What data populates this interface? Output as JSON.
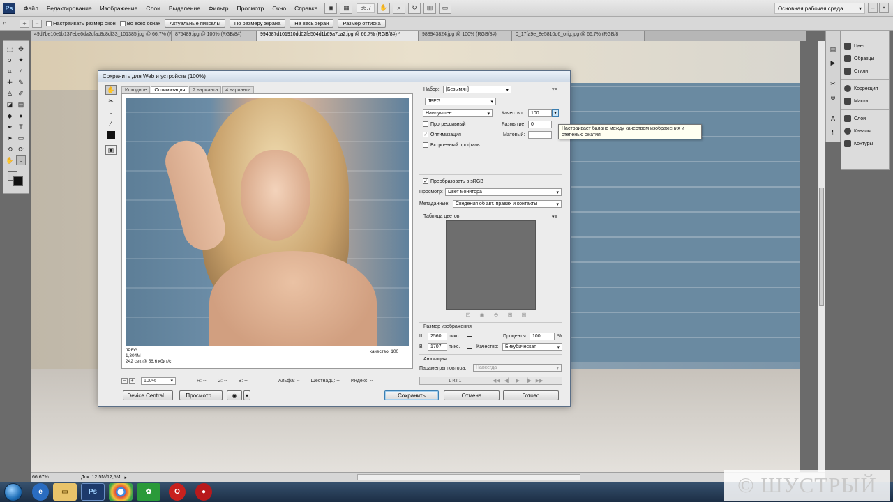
{
  "menubar": {
    "logo": "Ps",
    "items": [
      "Файл",
      "Редактирование",
      "Изображение",
      "Слои",
      "Выделение",
      "Фильтр",
      "Просмотр",
      "Окно",
      "Справка"
    ],
    "zoom": "66,7",
    "workspace": "Основная рабочая среда"
  },
  "options": {
    "resize_windows": "Настраивать размер окон",
    "all_windows": "Во всех окнах",
    "btn_actual": "Актуальные пикселы",
    "btn_fit": "По размеру экрана",
    "btn_fill": "На весь экран",
    "btn_print": "Размер оттиска"
  },
  "doc_tabs": [
    "49d7be10e1b137ebe6da2cfac8c8df33_101385.jpg @ 66,7% (RGB/8)",
    "875489.jpg @ 100% (RGB/8#)",
    "994687d101910dd02fe504d1b69a7ca2.jpg @ 66,7% (RGB/8#) *",
    "988943824.jpg @ 100% (RGB/8#)",
    "0_17fa9e_8e5810d6_orig.jpg @ 66,7% (RGB/8"
  ],
  "status": {
    "zoom": "66,67%",
    "doc": "Док: 12,5M/12,5M"
  },
  "panels": {
    "group1": [
      "Цвет",
      "Образцы",
      "Стили"
    ],
    "group2": [
      "Коррекция",
      "Маски"
    ],
    "group3": [
      "Слои",
      "Каналы",
      "Контуры"
    ]
  },
  "dialog": {
    "title": "Сохранить для Web и устройств (100%)",
    "tabs": [
      "Исходное",
      "Оптимизация",
      "2 варианта",
      "4 варианта"
    ],
    "preview_info": {
      "format": "JPEG",
      "size": "1,304M",
      "time": "242 сек @ 56,6 кбит/с"
    },
    "preview_quality": "качество: 100",
    "bottom": {
      "zoom": "100%",
      "r": "R: --",
      "g": "G: --",
      "b": "B: --",
      "alpha": "Альфа: --",
      "hex": "Шестнадц: --",
      "index": "Индекс: --"
    },
    "buttons": {
      "device": "Device Central...",
      "preview": "Просмотр...",
      "save": "Сохранить",
      "cancel": "Отмена",
      "done": "Готово"
    },
    "settings": {
      "preset_label": "Набор:",
      "preset_value": "[Безымян]",
      "format": "JPEG",
      "quality_preset": "Наилучшее",
      "quality_label": "Качество:",
      "quality_value": "100",
      "progressive": "Прогрессивный",
      "blur_label": "Размытие:",
      "blur_value": "0",
      "optimized": "Оптимизация",
      "matte_label": "Матовый:",
      "embed_profile": "Встроенный профиль",
      "convert_srgb": "Преобразовать в sRGB",
      "preview_label": "Просмотр:",
      "preview_value": "Цвет монитора",
      "meta_label": "Метаданные:",
      "meta_value": "Сведения об авт. правах и контакты",
      "color_table": "Таблица цветов",
      "image_size": "Размер изображения",
      "w_label": "Ш:",
      "w_value": "2560",
      "w_unit": "пикс.",
      "h_label": "В:",
      "h_value": "1707",
      "h_unit": "пикс.",
      "percent_label": "Проценты:",
      "percent_value": "100",
      "percent_unit": "%",
      "q2_label": "Качество:",
      "q2_value": "Бикубическая",
      "animation": "Анимация",
      "loop_label": "Параметры повтора:",
      "loop_value": "Навсегда",
      "frames": "1 из 1"
    },
    "tooltip": "Настраивает баланс между качеством изображения и степенью сжатия"
  },
  "watermark": "© ШУСТРЫЙ"
}
